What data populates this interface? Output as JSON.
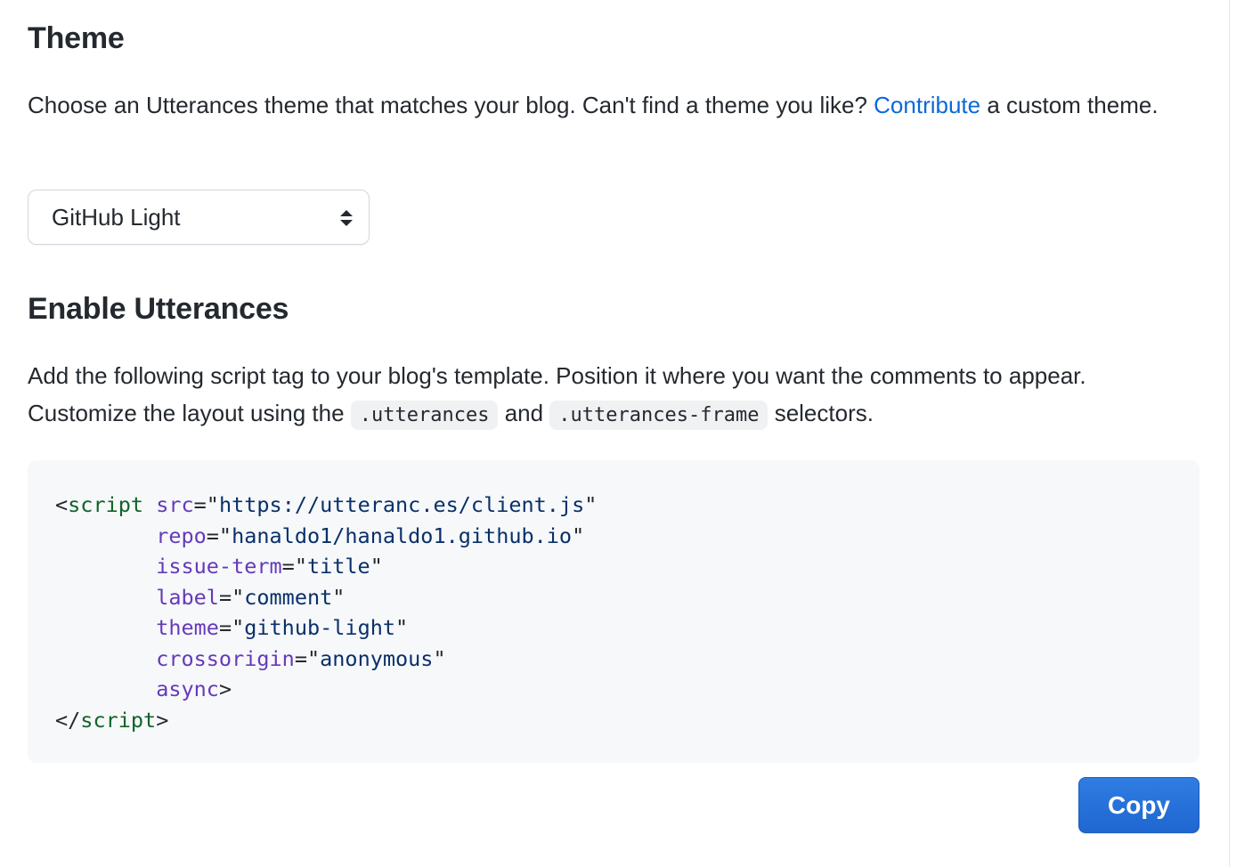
{
  "theme_section": {
    "heading": "Theme",
    "desc_prefix": "Choose an Utterances theme that matches your blog. Can't find a theme you like? ",
    "link_label": "Contribute",
    "desc_suffix": " a custom theme.",
    "select_value": "GitHub Light"
  },
  "enable_section": {
    "heading": "Enable Utterances",
    "desc_part1": "Add the following script tag to your blog's template. Position it where you want the comments to appear. Customize the layout using the ",
    "selector1": ".utterances",
    "desc_part2": " and ",
    "selector2": ".utterances-frame",
    "desc_part3": " selectors."
  },
  "code": {
    "open_tag": "script",
    "indent": "        ",
    "attrs": [
      {
        "name": "src",
        "value": "https://utteranc.es/client.js"
      },
      {
        "name": "repo",
        "value": "hanaldo1/hanaldo1.github.io"
      },
      {
        "name": "issue-term",
        "value": "title"
      },
      {
        "name": "label",
        "value": "comment"
      },
      {
        "name": "theme",
        "value": "github-light"
      },
      {
        "name": "crossorigin",
        "value": "anonymous"
      }
    ],
    "bool_attr": "async",
    "close_tag": "script"
  },
  "copy_button": {
    "label": "Copy"
  },
  "colors": {
    "link": "#0969da",
    "button": "#1f66d1",
    "code_bg": "#f6f8fa",
    "tag": "#116329",
    "attr": "#6639ba",
    "value": "#0a3069"
  },
  "icons": {
    "select_arrow": "updown-caret-icon"
  }
}
